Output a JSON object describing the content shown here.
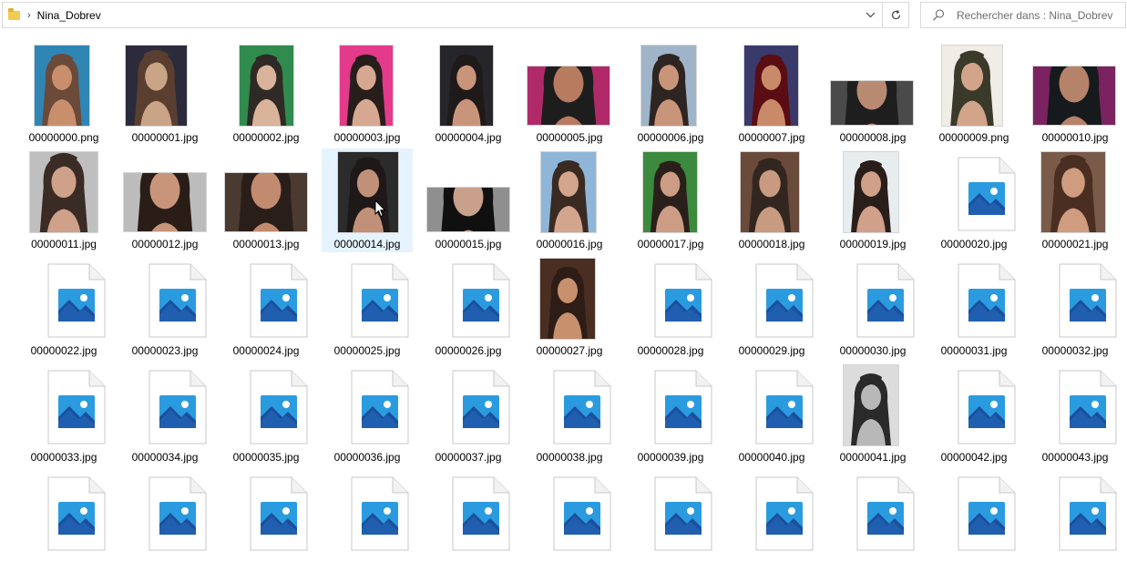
{
  "address_bar": {
    "folder": "Nina_Dobrev"
  },
  "search": {
    "placeholder": "Rechercher dans : Nina_Dobrev"
  },
  "files": [
    {
      "name": "00000000.png",
      "thumb": "photo",
      "tone": [
        "#6b4a3a",
        "#c98f6c",
        "#2f86b5"
      ]
    },
    {
      "name": "00000001.jpg",
      "thumb": "photo",
      "tone": [
        "#5a3e2f",
        "#c9a487",
        "#2b2b3c"
      ]
    },
    {
      "name": "00000002.jpg",
      "thumb": "photo",
      "tone": [
        "#2f2a26",
        "#d9b39a",
        "#2f8c4e"
      ]
    },
    {
      "name": "00000003.jpg",
      "thumb": "photo",
      "tone": [
        "#271d1b",
        "#d6a891",
        "#e33a8c"
      ]
    },
    {
      "name": "00000004.jpg",
      "thumb": "photo",
      "tone": [
        "#1f1a1a",
        "#c9957a",
        "#26262a"
      ]
    },
    {
      "name": "00000005.jpg",
      "thumb": "photo-wide",
      "tone": [
        "#1d1d1d",
        "#b77b60",
        "#b02a6a"
      ]
    },
    {
      "name": "00000006.jpg",
      "thumb": "photo",
      "tone": [
        "#2e2522",
        "#c9957a",
        "#9fb4c8"
      ]
    },
    {
      "name": "00000007.jpg",
      "thumb": "photo",
      "tone": [
        "#5a0d12",
        "#c98a6a",
        "#3a3a6a"
      ]
    },
    {
      "name": "00000008.jpg",
      "thumb": "photo-wide",
      "tone": [
        "#1f1e1e",
        "#b98a72",
        "#4a4a4a"
      ]
    },
    {
      "name": "00000009.png",
      "thumb": "photo",
      "tone": [
        "#3a3a2a",
        "#d2a48a",
        "#f0ece6"
      ]
    },
    {
      "name": "00000010.jpg",
      "thumb": "photo-wide",
      "tone": [
        "#161a1c",
        "#b5826a",
        "#7a2360"
      ]
    },
    {
      "name": "00000011.jpg",
      "thumb": "photo",
      "tone": [
        "#3a2b24",
        "#cfa08a",
        "#bfbfbf"
      ]
    },
    {
      "name": "00000012.jpg",
      "thumb": "photo-wide",
      "tone": [
        "#2a1d18",
        "#c9957a",
        "#bcbcbc"
      ]
    },
    {
      "name": "00000013.jpg",
      "thumb": "photo-wide",
      "tone": [
        "#2a1e1a",
        "#c28a6f",
        "#4a3a30"
      ]
    },
    {
      "name": "00000014.jpg",
      "thumb": "photo",
      "tone": [
        "#1e1818",
        "#c09078",
        "#2b2b2b"
      ],
      "selected": true
    },
    {
      "name": "00000015.jpg",
      "thumb": "photo-wide",
      "tone": [
        "#101010",
        "#c9a08a",
        "#8f8f8f"
      ]
    },
    {
      "name": "00000016.jpg",
      "thumb": "photo",
      "tone": [
        "#3a2a22",
        "#d2a58c",
        "#8fb6d8"
      ]
    },
    {
      "name": "00000017.jpg",
      "thumb": "photo",
      "tone": [
        "#2a1f1b",
        "#cc9c84",
        "#3b8a3e"
      ]
    },
    {
      "name": "00000018.jpg",
      "thumb": "photo",
      "tone": [
        "#332620",
        "#c89a80",
        "#6a4a3a"
      ]
    },
    {
      "name": "00000019.jpg",
      "thumb": "photo",
      "tone": [
        "#2a1e1a",
        "#d1a08a",
        "#e7ecef"
      ]
    },
    {
      "name": "00000020.jpg",
      "thumb": "generic"
    },
    {
      "name": "00000021.jpg",
      "thumb": "photo",
      "tone": [
        "#4a2e22",
        "#cf9c80",
        "#7a5a48"
      ]
    },
    {
      "name": "00000022.jpg",
      "thumb": "generic"
    },
    {
      "name": "00000023.jpg",
      "thumb": "generic"
    },
    {
      "name": "00000024.jpg",
      "thumb": "generic"
    },
    {
      "name": "00000025.jpg",
      "thumb": "generic"
    },
    {
      "name": "00000026.jpg",
      "thumb": "generic"
    },
    {
      "name": "00000027.jpg",
      "thumb": "photo",
      "tone": [
        "#2e1d16",
        "#c9906e",
        "#4a2e22"
      ]
    },
    {
      "name": "00000028.jpg",
      "thumb": "generic"
    },
    {
      "name": "00000029.jpg",
      "thumb": "generic"
    },
    {
      "name": "00000030.jpg",
      "thumb": "generic"
    },
    {
      "name": "00000031.jpg",
      "thumb": "generic"
    },
    {
      "name": "00000032.jpg",
      "thumb": "generic"
    },
    {
      "name": "00000033.jpg",
      "thumb": "generic"
    },
    {
      "name": "00000034.jpg",
      "thumb": "generic"
    },
    {
      "name": "00000035.jpg",
      "thumb": "generic"
    },
    {
      "name": "00000036.jpg",
      "thumb": "generic"
    },
    {
      "name": "00000037.jpg",
      "thumb": "generic"
    },
    {
      "name": "00000038.jpg",
      "thumb": "generic"
    },
    {
      "name": "00000039.jpg",
      "thumb": "generic"
    },
    {
      "name": "00000040.jpg",
      "thumb": "generic"
    },
    {
      "name": "00000041.jpg",
      "thumb": "photo-bw",
      "tone": [
        "#2a2a2a",
        "#b8b8b8",
        "#dcdcdc"
      ]
    },
    {
      "name": "00000042.jpg",
      "thumb": "generic"
    },
    {
      "name": "00000043.jpg",
      "thumb": "generic"
    },
    {
      "name": "",
      "thumb": "generic"
    },
    {
      "name": "",
      "thumb": "generic"
    },
    {
      "name": "",
      "thumb": "generic"
    },
    {
      "name": "",
      "thumb": "generic"
    },
    {
      "name": "",
      "thumb": "generic"
    },
    {
      "name": "",
      "thumb": "generic"
    },
    {
      "name": "",
      "thumb": "generic"
    },
    {
      "name": "",
      "thumb": "generic"
    },
    {
      "name": "",
      "thumb": "generic"
    },
    {
      "name": "",
      "thumb": "generic"
    },
    {
      "name": "",
      "thumb": "generic"
    }
  ]
}
